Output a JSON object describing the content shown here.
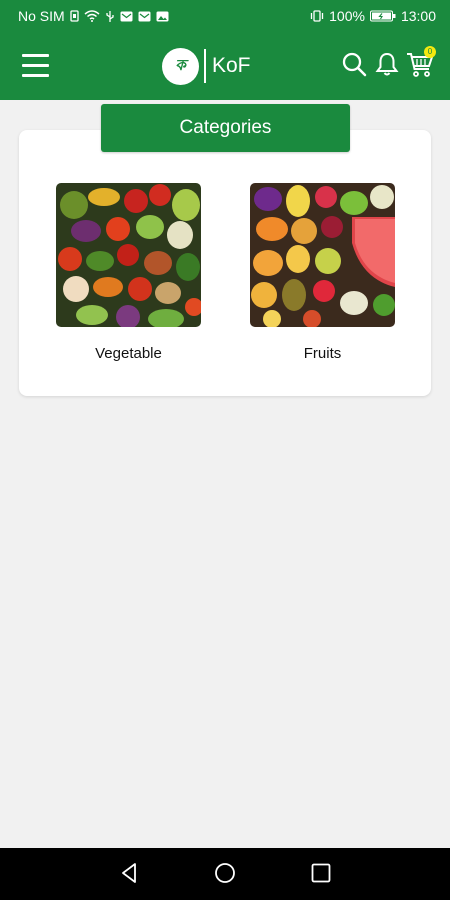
{
  "status_bar": {
    "carrier": "No SIM",
    "battery": "100%",
    "time": "13:00"
  },
  "header": {
    "logo_text": "KoF",
    "logo_mark": "ক"
  },
  "cart": {
    "badge": "0"
  },
  "categories": {
    "title": "Categories",
    "items": [
      {
        "label": "Vegetable"
      },
      {
        "label": "Fruits"
      }
    ]
  },
  "colors": {
    "brand_green": "#1a8a3e",
    "background": "#f1f1f1",
    "badge_yellow": "#f5e90f"
  }
}
